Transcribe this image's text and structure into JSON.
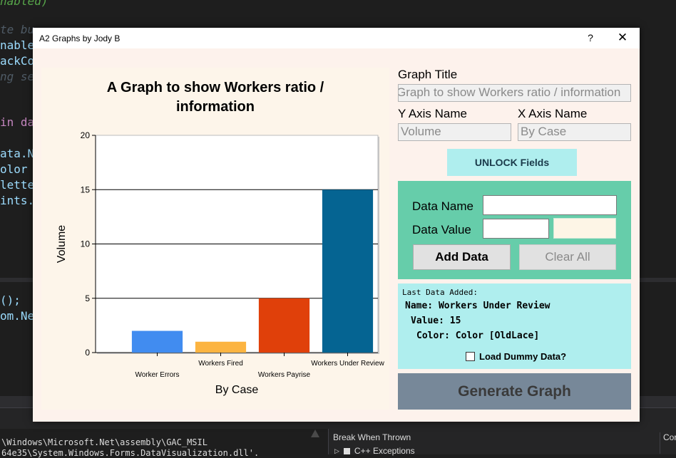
{
  "ide": {
    "code_lines": [
      "nabled)",
      "te bu",
      "nable",
      "ackCo",
      "ng se",
      "in da",
      "ata.N",
      "olor =",
      "lette",
      "ints.",
      "();",
      "om.Ne"
    ],
    "output_lines": [
      "\\Windows\\Microsoft.Net\\assembly\\GAC_MSIL",
      "64e35\\System.Windows.Forms.DataVisualization.dll'."
    ],
    "break_header": "Break When Thrown",
    "break_item": "C++ Exceptions",
    "break_col2": "Cor"
  },
  "window": {
    "title": "A2 Graphs by Jody B",
    "help_label": "?",
    "close_label": "✕"
  },
  "form": {
    "graph_title_label": "Graph Title",
    "graph_title_value": "Graph to show Workers ratio / information",
    "y_axis_label": "Y Axis Name",
    "y_axis_value": "Volume",
    "x_axis_label": "X Axis Name",
    "x_axis_value": "By Case",
    "unlock_label": "UNLOCK Fields",
    "data_name_label": "Data Name",
    "data_value_label": "Data Value",
    "data_name_value": "",
    "data_value_value": "",
    "add_label": "Add Data",
    "clear_label": "Clear All",
    "generate_label": "Generate Graph",
    "dummy_label": "Load Dummy Data?",
    "dummy_checked": false
  },
  "last_added": {
    "header": "Last Data Added:",
    "name_line": "Name: Workers Under Review",
    "value_line": "Value: 15",
    "color_line": "Color: Color [OldLace]"
  },
  "colors": {
    "data_panel": "#66cdaa",
    "info_panel": "#afeeee",
    "generate_button": "#778899",
    "swatch": "#fdf5e6"
  },
  "chart_data": {
    "type": "bar",
    "title": "A Graph to show Workers ratio / information",
    "categories": [
      "Worker Errors",
      "Workers Fired",
      "Workers Payrise",
      "Workers Under Review"
    ],
    "values": [
      2,
      1,
      5,
      15
    ],
    "colors": [
      "#418cf0",
      "#fcb441",
      "#e0400a",
      "#056492"
    ],
    "xlabel": "By Case",
    "ylabel": "Volume",
    "ylim": [
      0,
      20
    ],
    "yticks": [
      0,
      5,
      10,
      15,
      20
    ],
    "grid": true,
    "legend": "none"
  }
}
